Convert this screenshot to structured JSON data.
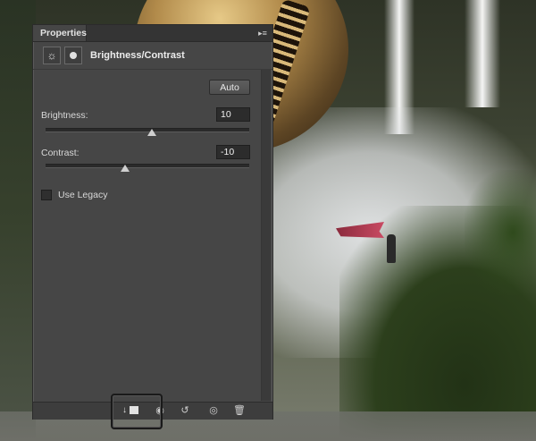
{
  "panel": {
    "tab_label": "Properties",
    "menu_icon": "panel-menu-icon",
    "adjustment_title": "Brightness/Contrast",
    "adjustment_icon": "brightness-contrast-icon",
    "mask_icon": "layer-mask-icon",
    "auto_label": "Auto",
    "brightness": {
      "label": "Brightness:",
      "value": "10",
      "slider_fraction": 0.52
    },
    "contrast": {
      "label": "Contrast:",
      "value": "-10",
      "slider_fraction": 0.39
    },
    "use_legacy": {
      "label": "Use Legacy",
      "checked": false
    }
  },
  "bottom_bar": {
    "icons": [
      "clip-to-layer-icon",
      "view-previous-state-icon",
      "reset-icon",
      "visibility-eye-icon",
      "trash-icon"
    ]
  }
}
